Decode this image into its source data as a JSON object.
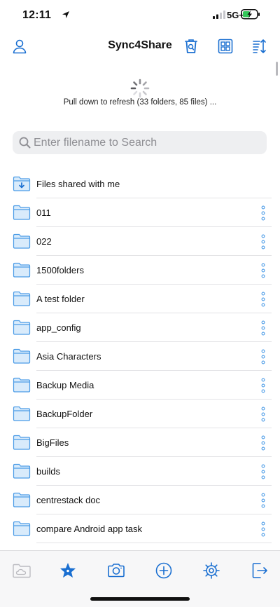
{
  "status_bar": {
    "time": "12:11",
    "network": "5G+"
  },
  "header": {
    "title": "Sync4Share"
  },
  "refresh": {
    "text": "Pull down to refresh (33 folders, 85 files) ..."
  },
  "search": {
    "placeholder": "Enter filename to Search"
  },
  "shared_item": {
    "label": "Files shared with me"
  },
  "folders": [
    "011",
    "022",
    "1500folders",
    "A test folder",
    "app_config",
    "Asia Characters",
    "Backup Media",
    "BackupFolder",
    "BigFiles",
    "builds",
    "centrestack doc",
    "compare Android app task"
  ],
  "colors": {
    "accent": "#1a6fd1",
    "folder_fill": "#d9ebfb",
    "folder_stroke": "#4a9be6",
    "battery": "#34c759"
  },
  "tab_bar": {
    "active": "favorites-tab"
  }
}
